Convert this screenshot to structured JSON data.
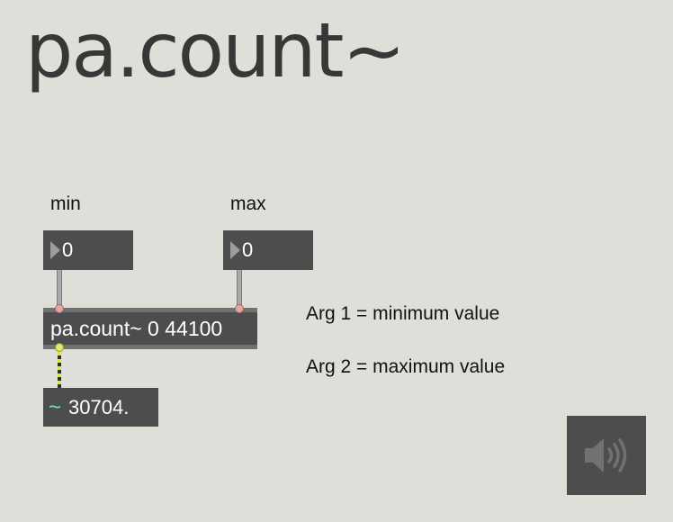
{
  "title": "pa.count~",
  "labels": {
    "min": "min",
    "max": "max"
  },
  "number_boxes": {
    "min_value": "0",
    "max_value": "0"
  },
  "object_box": {
    "text": "pa.count~ 0 44100"
  },
  "signal_display": {
    "glyph": "~",
    "value": "30704."
  },
  "comments": {
    "arg1": "Arg 1 = minimum value",
    "arg2": "Arg 2 = maximum value"
  },
  "icons": {
    "dac_toggle": "speaker-icon",
    "number_arrow": "triangle-right-icon"
  },
  "colors": {
    "background": "#dedfd9",
    "box": "#4b4e4d",
    "signal_cord": "#d9e64a",
    "signal_glyph": "#6fe2e6",
    "inlet": "#e3a7a7"
  }
}
